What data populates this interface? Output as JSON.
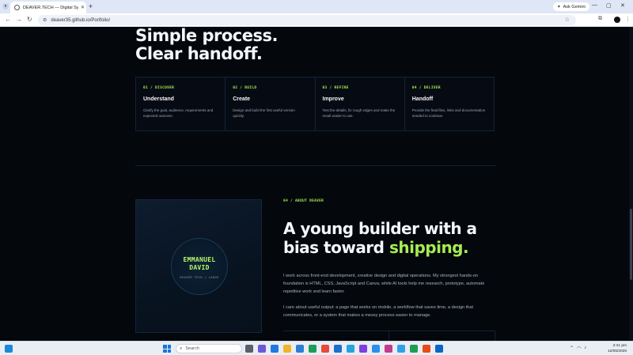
{
  "browser": {
    "tab_title": "DEAVER.TECH — Digital System",
    "tab_close": "✕",
    "new_tab": "+",
    "ask_label": "Ask Gemini",
    "url": "deaver35.github.io/Portfolio/",
    "win_min": "—",
    "win_max": "▢",
    "win_close": "✕"
  },
  "process": {
    "title_line1": "Simple process.",
    "title_line2": "Clear handoff.",
    "steps": [
      {
        "kicker": "01 / DISCOVER",
        "title": "Understand",
        "desc": "Clarify the goal, audience, requirements and expected outcome."
      },
      {
        "kicker": "02 / BUILD",
        "title": "Create",
        "desc": "Design and build the first useful version quickly."
      },
      {
        "kicker": "03 / REFINE",
        "title": "Improve",
        "desc": "Test the details, fix rough edges and make the result easier to use."
      },
      {
        "kicker": "04 / DELIVER",
        "title": "Handoff",
        "desc": "Provide the final files, links and documentation needed to continue."
      }
    ]
  },
  "about": {
    "kicker": "04 / ABOUT DEAVER",
    "title_main": "A young builder with a bias toward ",
    "title_accent": "shipping.",
    "portrait_name_line1": "EMMANUEL",
    "portrait_name_line2": "DAVID",
    "portrait_role": "DEAVER TECH / LAGOS",
    "p1": "I work across front-end development, creative design and digital operations. My strongest hands-on foundation is HTML, CSS, JavaScript and Canva, while AI tools help me research, prototype, automate repetitive work and learn faster.",
    "p2": "I care about useful output: a page that works on mobile, a workflow that saves time, a design that communicates, or a system that makes a messy process easier to manage."
  },
  "taskbar": {
    "search_label": "Search",
    "time": "2:41 pm",
    "date": "12/05/2026",
    "app_colors": [
      "#5a5f6a",
      "#6b59d8",
      "#1f7ae0",
      "#f0b429",
      "#2a7fd4",
      "#1e9c5a",
      "#e54b3c",
      "#1d6fc9",
      "#27a3e0",
      "#7b3fe4",
      "#2b8ee8",
      "#c23b8c",
      "#31a0ea",
      "#1f9d55",
      "#e64a19",
      "#0a66c2"
    ]
  }
}
